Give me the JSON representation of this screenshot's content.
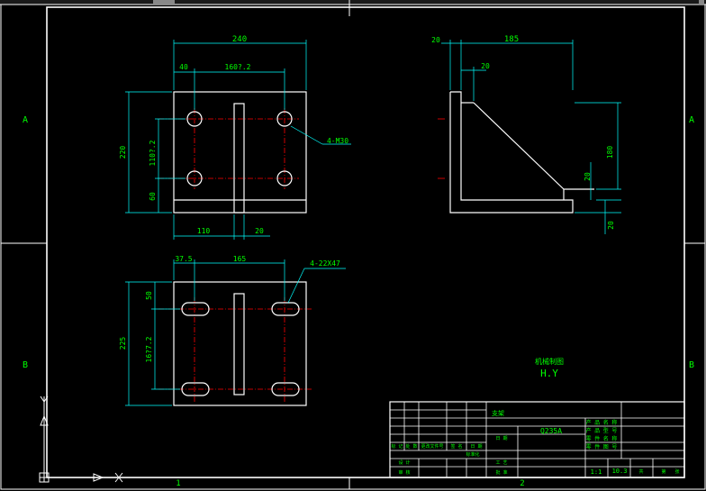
{
  "colors": {
    "background": "#000000",
    "part": "#ffffff",
    "dimension": "#00ffff",
    "dim_text": "#00ff00",
    "centerline": "#ff0000",
    "hidden": "#ff0000",
    "title": "#00ff00",
    "label": "#00ff00",
    "frame_text": "#00ff00"
  },
  "frame": {
    "zone_left_top": "A",
    "zone_left_bottom": "B",
    "zone_right_top": "A",
    "zone_right_bottom": "B",
    "col_bottom_left": "1",
    "col_bottom_mid": "2"
  },
  "front_view": {
    "dims": {
      "overall_width": "240",
      "hole_offset": "40",
      "hole_spacing": "160?.2",
      "height": "220",
      "inner_height": "110?.2",
      "bottom_edge": "60",
      "bottom_left": "110",
      "rib_width": "20"
    },
    "hole_note": "4-M30"
  },
  "side_view": {
    "dims": {
      "top_left": "20",
      "top_width": "185",
      "rib_offset": "20",
      "height": "180",
      "foot_height": "20",
      "base_thickness": "20"
    }
  },
  "top_view": {
    "dims": {
      "left_offset": "37.5",
      "slot_spacing": "165",
      "top_edge": "50",
      "height": "225",
      "inner_height": "16?7.2"
    },
    "slot_note": "4-22X47"
  },
  "label": {
    "line1": "机械制图",
    "line2": "H.Y"
  },
  "title_block": {
    "part_name": "支架",
    "material": "Q235A",
    "scale": "1:1",
    "weight": "10.3",
    "r_col1": [
      "产 品 名 称",
      "产 品 型 号",
      "零 件 名 称",
      "零 件 图 号"
    ],
    "rows": [
      "标 记",
      "处 数",
      "更改文件号",
      "签 名",
      "日 期"
    ],
    "designer": "设 计",
    "checker": "审 核",
    "craft": "工 艺",
    "standard": "标准化",
    "approve": "批 准",
    "date_label": "日 期",
    "sheet": "共",
    "page": "第",
    "zhang": "张"
  }
}
